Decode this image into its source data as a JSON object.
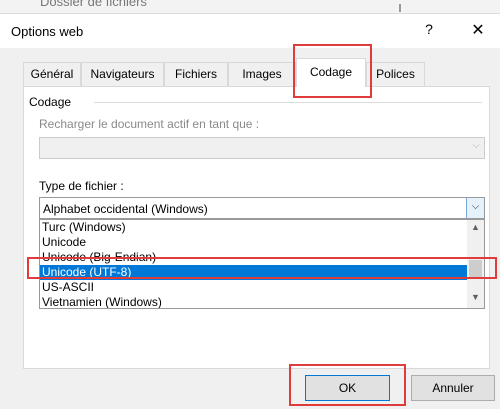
{
  "background": {
    "text": "Dossier de fichiers"
  },
  "window": {
    "title": "Options web",
    "help_label": "?",
    "close_label": "✕"
  },
  "tabs": [
    {
      "label": "Général"
    },
    {
      "label": "Navigateurs"
    },
    {
      "label": "Fichiers"
    },
    {
      "label": "Images"
    },
    {
      "label": "Codage",
      "active": true
    },
    {
      "label": "Polices"
    }
  ],
  "codage": {
    "group_label": "Codage",
    "reload_label": "Recharger le document actif en tant que :",
    "reload_value": "",
    "type_label": "Type de fichier :",
    "type_value": "Alphabet occidental (Windows)",
    "list_items": [
      "Turc (Windows)",
      "Unicode",
      "Unicode (Big-Endian)",
      "Unicode (UTF-8)",
      "US-ASCII",
      "Vietnamien (Windows)"
    ],
    "selected_index": 3
  },
  "buttons": {
    "ok_label": "OK",
    "cancel_label": "Annuler"
  },
  "colors": {
    "selection": "#0078d7",
    "highlight": "#e03c3c"
  },
  "icons": {
    "dropdown": "chevron-down-icon",
    "scroll_up": "chevron-up-icon",
    "scroll_down": "chevron-down-icon"
  }
}
